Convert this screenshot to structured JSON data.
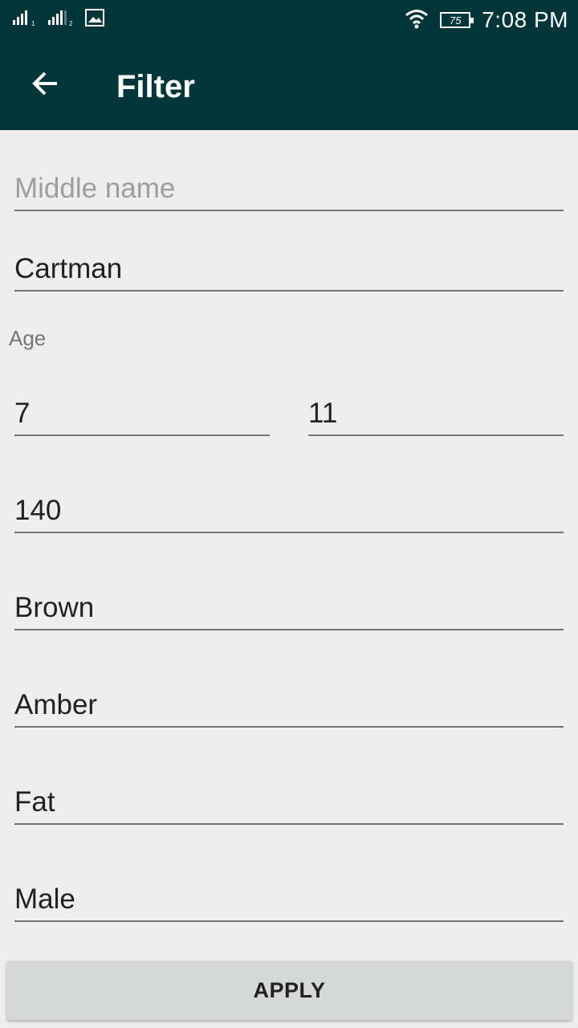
{
  "status_bar": {
    "time": "7:08 PM",
    "battery_level": "75",
    "icons": [
      "signal-sim1-icon",
      "signal-sim2-icon",
      "image-notification-icon",
      "wifi-icon",
      "battery-icon"
    ]
  },
  "toolbar": {
    "title": "Filter",
    "back_icon": "arrow-back-icon"
  },
  "form": {
    "middle_name": {
      "placeholder": "Middle name",
      "value": ""
    },
    "last_name": {
      "value": "Cartman"
    },
    "age_label": "Age",
    "age_from": {
      "value": "7"
    },
    "age_to": {
      "value": "11"
    },
    "height": {
      "value": "140"
    },
    "hair_color": {
      "value": "Brown"
    },
    "eye_color": {
      "value": "Amber"
    },
    "build": {
      "value": "Fat"
    },
    "gender": {
      "value": "Male"
    }
  },
  "apply_button": {
    "label": "APPLY"
  },
  "colors": {
    "primary_dark": "#00363a",
    "background": "#eeeeee",
    "button": "#d6d7d7"
  }
}
